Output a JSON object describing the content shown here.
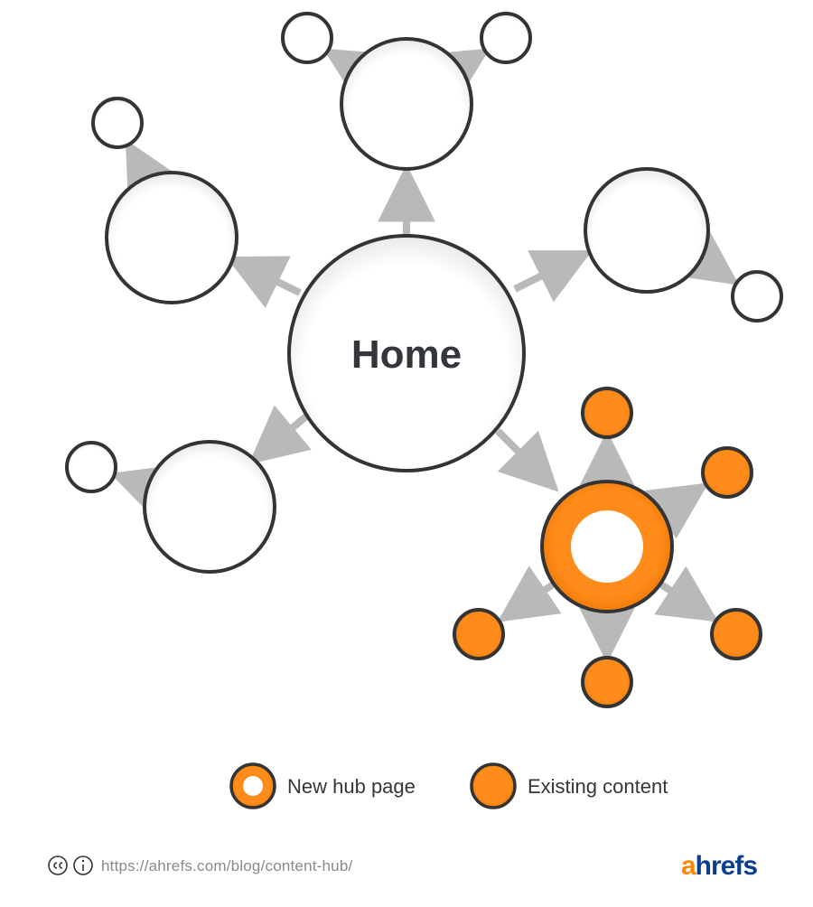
{
  "diagram": {
    "center_label": "Home",
    "legend": {
      "new_hub": "New hub page",
      "existing": "Existing content"
    }
  },
  "footer": {
    "url": "https://ahrefs.com/blog/content-hub/",
    "brand_a": "a",
    "brand_rest": "hrefs"
  },
  "colors": {
    "stroke": "#343434",
    "arrow": "#b9b9b9",
    "white": "#ffffff",
    "orange": "#ff8800",
    "shadow": "#dcdcdc"
  }
}
